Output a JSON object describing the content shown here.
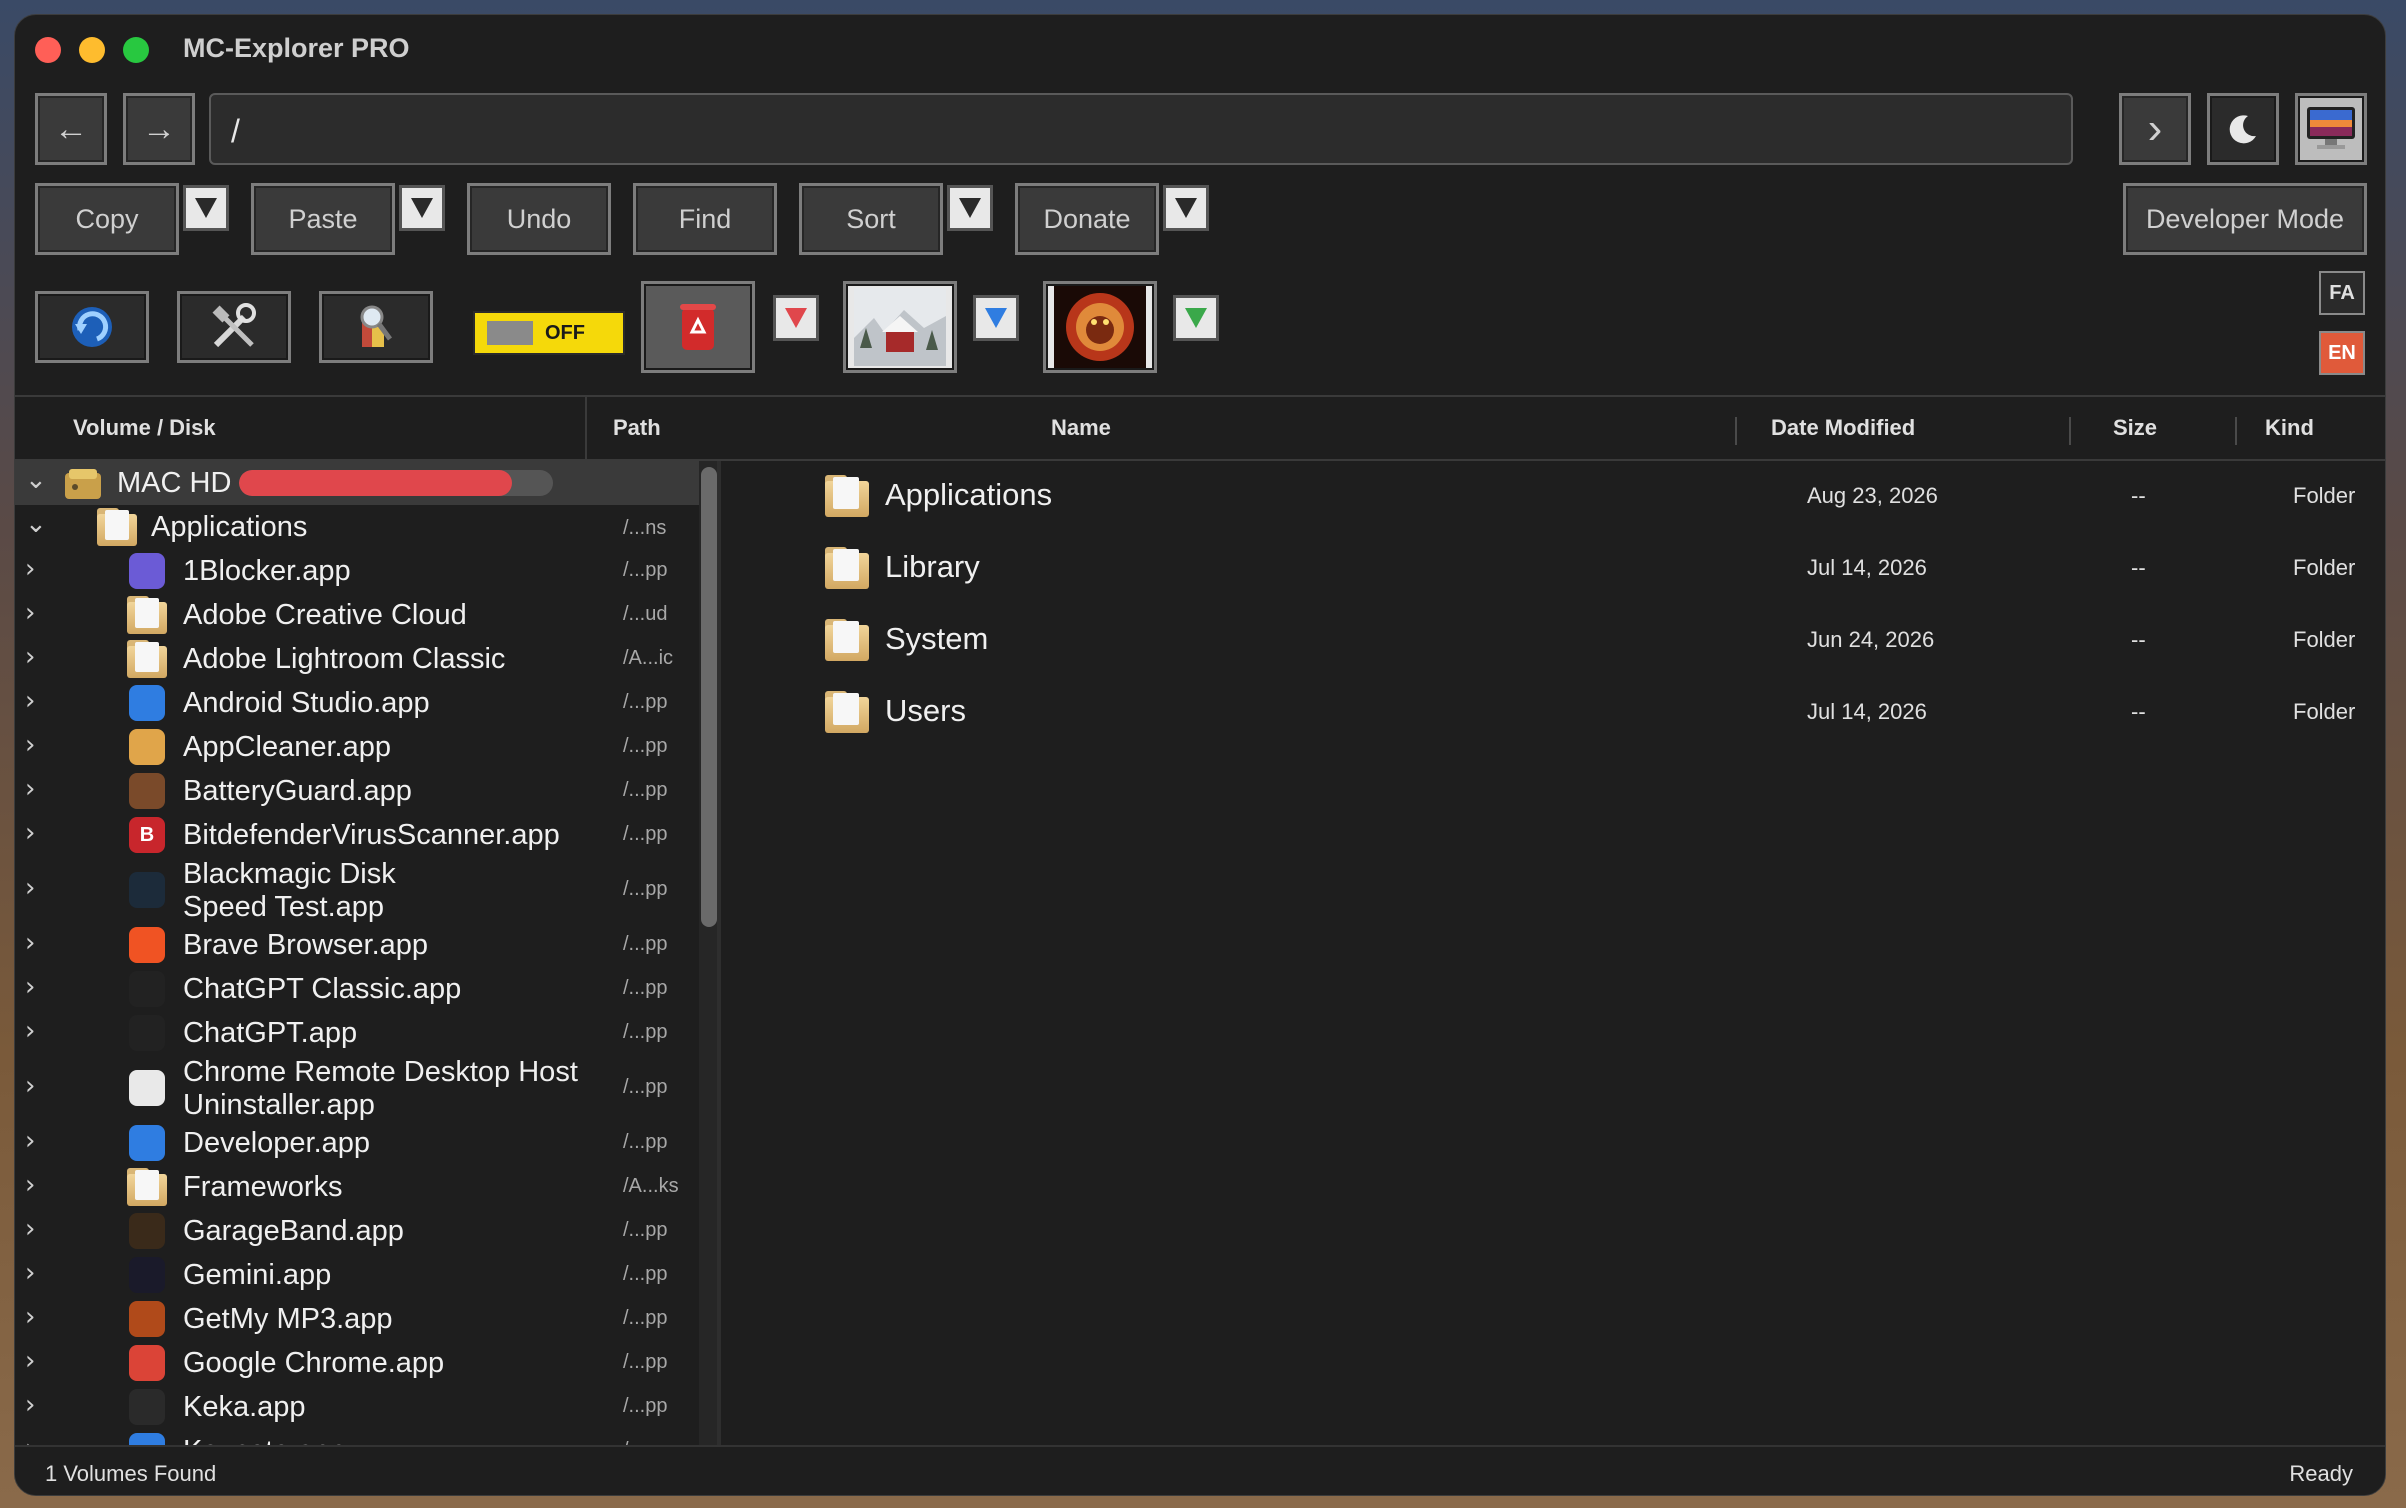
{
  "window": {
    "title": "MC-Explorer PRO"
  },
  "toolbar": {
    "path_value": "/",
    "back_glyph": "←",
    "forward_glyph": "→",
    "go_glyph": "›",
    "copy_label": "Copy",
    "paste_label": "Paste",
    "undo_label": "Undo",
    "find_label": "Find",
    "sort_label": "Sort",
    "donate_label": "Donate",
    "developer_mode_label": "Developer Mode",
    "toggle_label": "OFF",
    "lang_fa": "FA",
    "lang_en": "EN"
  },
  "left_headers": {
    "volume": "Volume / Disk",
    "path": "Path"
  },
  "right_headers": {
    "name": "Name",
    "date": "Date Modified",
    "size": "Size",
    "kind": "Kind"
  },
  "volume": {
    "name": "MAC HD",
    "usage_fraction": 0.87
  },
  "tree": {
    "root_folder": {
      "name": "Applications",
      "path": "/...ns"
    },
    "items": [
      {
        "name": "1Blocker.app",
        "path": "/...pp",
        "icon": "1blocker-icon",
        "color": "#6b5bd6"
      },
      {
        "name": "Adobe Creative Cloud",
        "path": "/...ud",
        "icon": "folder-icon"
      },
      {
        "name": "Adobe Lightroom Classic",
        "path": "/A...ic",
        "icon": "folder-icon"
      },
      {
        "name": "Android Studio.app",
        "path": "/...pp",
        "icon": "app-store-icon",
        "color": "#2f7de1"
      },
      {
        "name": "AppCleaner.app",
        "path": "/...pp",
        "icon": "appcleaner-icon",
        "color": "#e0a54a"
      },
      {
        "name": "BatteryGuard.app",
        "path": "/...pp",
        "icon": "batteryguard-icon",
        "color": "#7a4a2a"
      },
      {
        "name": "BitdefenderVirusScanner.app",
        "path": "/...pp",
        "icon": "bitdefender-icon",
        "color": "#c8262c",
        "letter": "B"
      },
      {
        "name": "Blackmagic Disk",
        "name2": "Speed Test.app",
        "path": "/...pp",
        "icon": "blackmagic-icon",
        "color": "#1c2b3a"
      },
      {
        "name": "Brave Browser.app",
        "path": "/...pp",
        "icon": "brave-icon",
        "color": "#f05323"
      },
      {
        "name": "ChatGPT Classic.app",
        "path": "/...pp",
        "icon": "chatgpt-icon",
        "color": "#222222"
      },
      {
        "name": "ChatGPT.app",
        "path": "/...pp",
        "icon": "chatgpt-icon",
        "color": "#222222"
      },
      {
        "name": "Chrome Remote Desktop Host",
        "name2": "Uninstaller.app",
        "path": "/...pp",
        "icon": "chrome-remote-icon",
        "color": "#e9e9e9"
      },
      {
        "name": "Developer.app",
        "path": "/...pp",
        "icon": "developer-icon",
        "color": "#2f7de1"
      },
      {
        "name": "Frameworks",
        "path": "/A...ks",
        "icon": "folder-icon"
      },
      {
        "name": "GarageBand.app",
        "path": "/...pp",
        "icon": "garageband-icon",
        "color": "#3a2a1a"
      },
      {
        "name": "Gemini.app",
        "path": "/...pp",
        "icon": "gemini-icon",
        "color": "#1a1a2a"
      },
      {
        "name": "GetMy MP3.app",
        "path": "/...pp",
        "icon": "getmymp3-icon",
        "color": "#b04a1a"
      },
      {
        "name": "Google Chrome.app",
        "path": "/...pp",
        "icon": "chrome-icon",
        "color": "#db4437"
      },
      {
        "name": "Keka.app",
        "path": "/...pp",
        "icon": "keka-icon",
        "color": "#2a2a2a"
      },
      {
        "name": "Keynote.app",
        "path": "/...pp",
        "icon": "keynote-icon",
        "color": "#2f7de1"
      }
    ]
  },
  "files": [
    {
      "name": "Applications",
      "date": "Aug 23, 2026",
      "size": "--",
      "kind": "Folder"
    },
    {
      "name": "Library",
      "date": "Jul 14, 2026",
      "size": "--",
      "kind": "Folder"
    },
    {
      "name": "System",
      "date": "Jun 24, 2026",
      "size": "--",
      "kind": "Folder"
    },
    {
      "name": "Users",
      "date": "Jul 14, 2026",
      "size": "--",
      "kind": "Folder"
    }
  ],
  "status": {
    "left": "1 Volumes Found",
    "right": "Ready"
  },
  "colors": {
    "close": "#ff5f57",
    "minimize": "#febc2e",
    "zoom": "#28c840",
    "volume_bar": "#e0474c",
    "toggle": "#f5d90a",
    "lang_en": "#e05a3a"
  }
}
